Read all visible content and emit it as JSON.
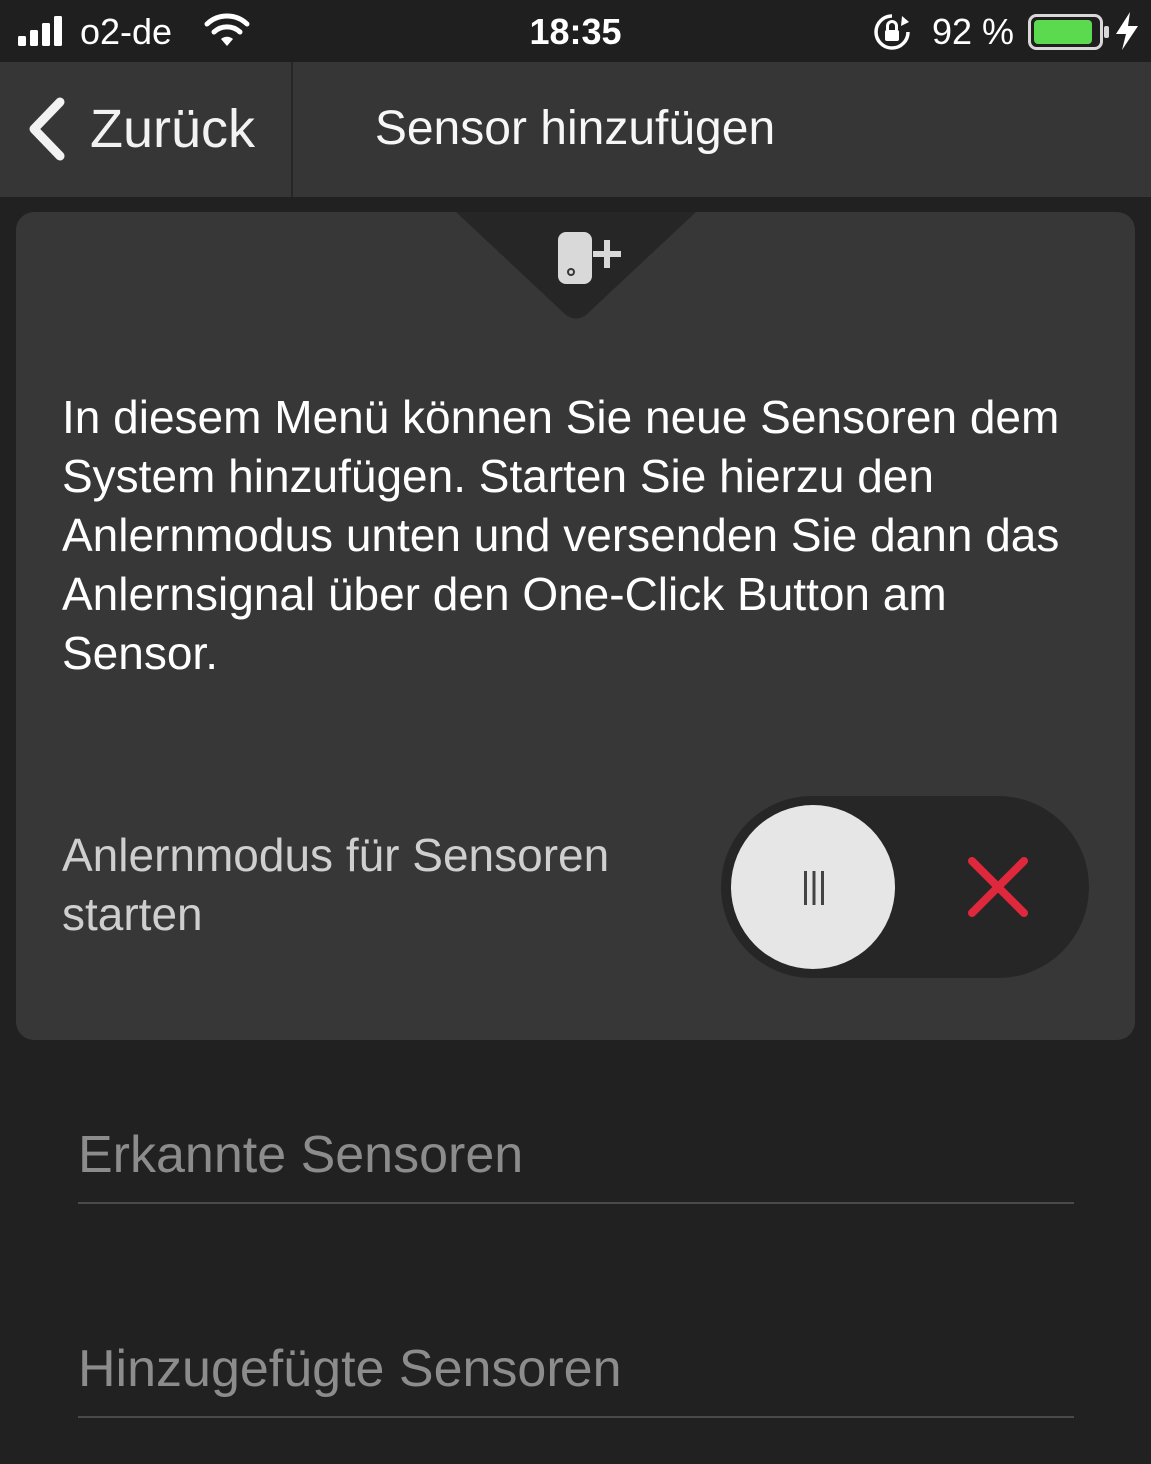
{
  "status_bar": {
    "carrier": "o2-de",
    "time": "18:35",
    "battery_percent": "92 %",
    "battery_level": 0.92,
    "icons": [
      "signal-icon",
      "wifi-icon",
      "rotation-lock-icon",
      "battery-icon",
      "charging-bolt-icon"
    ]
  },
  "nav": {
    "back_label": "Zurück",
    "title": "Sensor hinzufügen",
    "back_icon": "chevron-left-icon"
  },
  "card": {
    "icon": "sensor-add-icon",
    "description": "In diesem Menü können Sie neue Sensoren dem System hinzufügen. Starten Sie hierzu den Anlernmodus unten und versenden Sie dann das Anlernsignal über den One-Click Button am Sensor.",
    "toggle_label": "Anlernmodus für Sensoren starten",
    "toggle_state": "off"
  },
  "sections": {
    "detected": "Erkannte Sensoren",
    "added": "Hinzugefügte Sensoren"
  },
  "colors": {
    "background": "#212121",
    "nav_background": "#363636",
    "card_background": "#373737",
    "toggle_off_x": "#e0283c",
    "battery_green": "#5bd94f"
  }
}
